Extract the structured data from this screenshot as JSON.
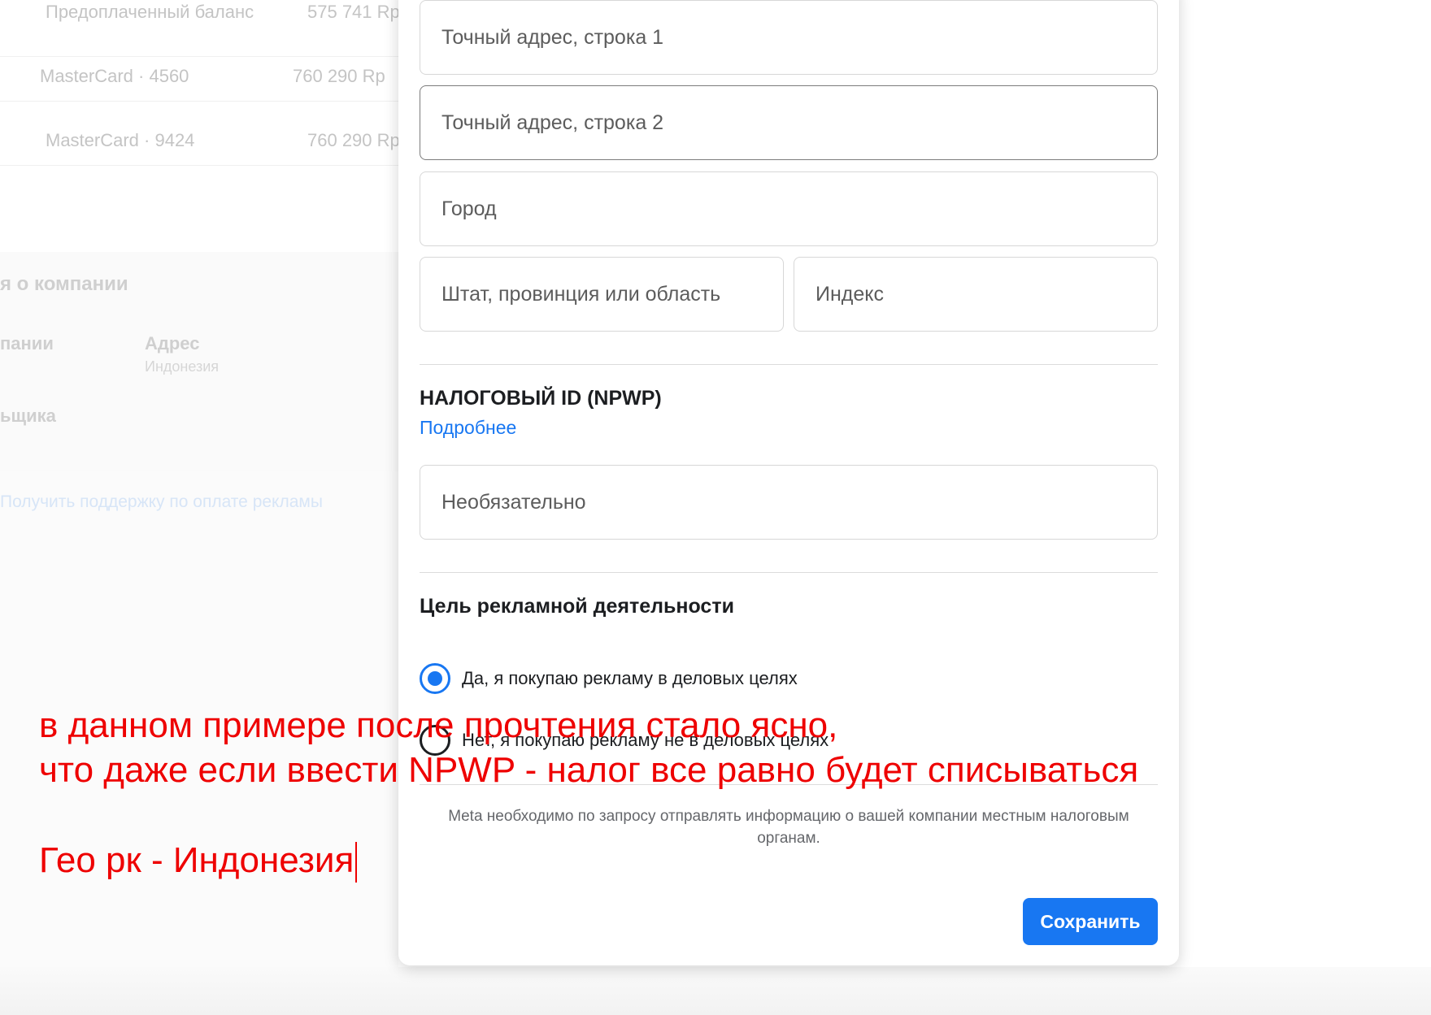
{
  "background": {
    "payment_methods": [
      {
        "method": "Предоплаченный баланс",
        "amount": "575 741 Rp"
      },
      {
        "method": "MasterCard · 4560",
        "amount": "760 290 Rp"
      },
      {
        "method": "MasterCard · 9424",
        "amount": "760 290 Rp"
      }
    ],
    "company_heading": "я о компании",
    "company_name_label": "пании",
    "address_label": "Адрес",
    "address_value": "Индонезия",
    "taxpayer_label": "ьщика",
    "support_link": "Получить поддержку по оплате рекламы"
  },
  "modal": {
    "address": {
      "line1_placeholder": "Точный адрес, строка 1",
      "line2_placeholder": "Точный адрес, строка 2",
      "city_placeholder": "Город",
      "state_placeholder": "Штат, провинция или область",
      "zip_placeholder": "Индекс"
    },
    "tax": {
      "title": "НАЛОГОВЫЙ ID (NPWP)",
      "learn_more": "Подробнее",
      "placeholder": "Необязательно"
    },
    "purpose": {
      "title": "Цель рекламной деятельности",
      "options": [
        {
          "label": "Да, я покупаю рекламу в деловых целях",
          "checked": true
        },
        {
          "label": "Нет, я покупаю рекламу не в деловых целях",
          "checked": false
        }
      ]
    },
    "disclaimer": "Meta необходимо по запросу отправлять информацию о вашей компании местным налоговым органам.",
    "save_label": "Сохранить"
  },
  "annotation": {
    "line1": "в данном примере после прочтения стало ясно,",
    "line2": "что даже если ввести NPWP - налог все равно будет списываться",
    "line3": "Гео рк - Индонезия",
    "color": "#ee0000"
  },
  "colors": {
    "accent": "#1877f2",
    "annotation": "#ee0000"
  }
}
